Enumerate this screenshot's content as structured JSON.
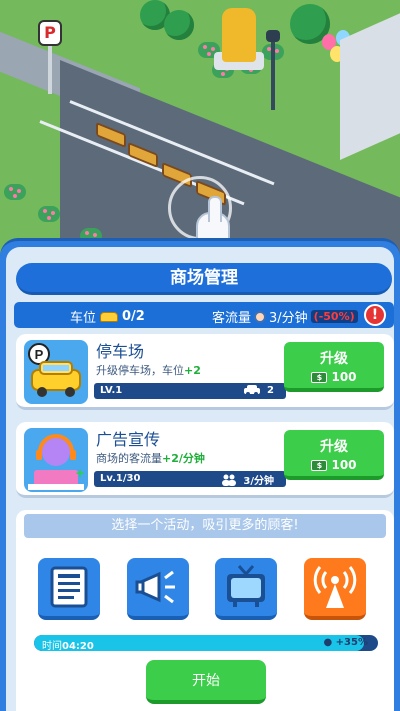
{
  "scene": {
    "parking_sign": "P"
  },
  "panel": {
    "title": "商场管理",
    "status": {
      "parking_label": "车位",
      "parking_value": "0/2",
      "traffic_label": "客流量",
      "traffic_value": "3/分钟",
      "traffic_penalty": "(-50%)",
      "warning": "!"
    },
    "cards": [
      {
        "title": "停车场",
        "desc_prefix": "升级停车场，车位",
        "desc_plus": "+2",
        "level": "LV.1",
        "level_value": "2",
        "level_icon": "car-icon",
        "button_label": "升级",
        "cost": "100"
      },
      {
        "title": "广告宣传",
        "desc_prefix": "商场的客流量",
        "desc_plus": "+2/分钟",
        "level": "Lv.1/30",
        "level_value": "3/分钟",
        "level_icon": "people-icon",
        "button_label": "升级",
        "cost": "100"
      }
    ],
    "activity": {
      "header": "选择一个活动，吸引更多的顾客!",
      "options": [
        "newspaper-icon",
        "megaphone-icon",
        "tv-icon",
        "broadcast-tower-icon"
      ],
      "timer_label": "时间",
      "timer_value": "04:20",
      "timer_progress": 0.96,
      "bonus": "+35%",
      "start_label": "开始"
    }
  },
  "colors": {
    "panel_blue": "#2f7ee0",
    "button_green": "#3ccd4a",
    "penalty_red": "#ff3b3b",
    "plus_green": "#1fae3a"
  }
}
